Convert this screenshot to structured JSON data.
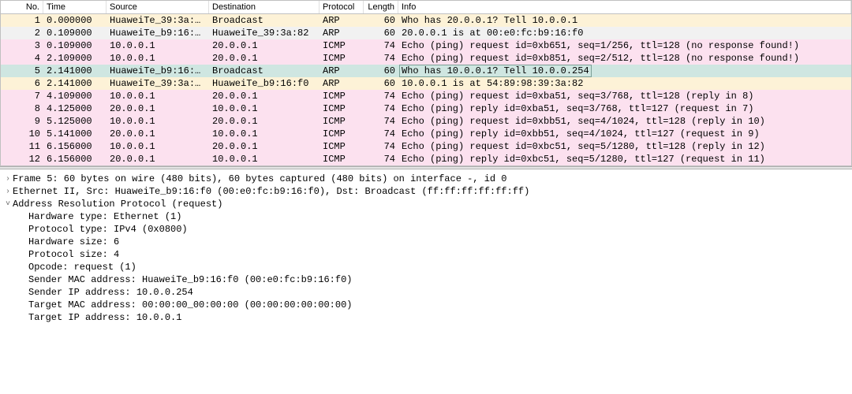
{
  "columns": {
    "no": "No.",
    "time": "Time",
    "source": "Source",
    "destination": "Destination",
    "protocol": "Protocol",
    "length": "Length",
    "info": "Info"
  },
  "packets": [
    {
      "no": "1",
      "time": "0.000000",
      "src": "HuaweiTe_39:3a:…",
      "dst": "Broadcast",
      "proto": "ARP",
      "len": "60",
      "info": "Who has 20.0.0.1? Tell 10.0.0.1",
      "cls": "arp-brd"
    },
    {
      "no": "2",
      "time": "0.109000",
      "src": "HuaweiTe_b9:16:…",
      "dst": "HuaweiTe_39:3a:82",
      "proto": "ARP",
      "len": "60",
      "info": "20.0.0.1 is at 00:e0:fc:b9:16:f0",
      "cls": "arp-resp"
    },
    {
      "no": "3",
      "time": "0.109000",
      "src": "10.0.0.1",
      "dst": "20.0.0.1",
      "proto": "ICMP",
      "len": "74",
      "info": "Echo (ping) request  id=0xb651, seq=1/256, ttl=128 (no response found!)",
      "cls": "icmp"
    },
    {
      "no": "4",
      "time": "2.109000",
      "src": "10.0.0.1",
      "dst": "20.0.0.1",
      "proto": "ICMP",
      "len": "74",
      "info": "Echo (ping) request  id=0xb851, seq=2/512, ttl=128 (no response found!)",
      "cls": "icmp"
    },
    {
      "no": "5",
      "time": "2.141000",
      "src": "HuaweiTe_b9:16:…",
      "dst": "Broadcast",
      "proto": "ARP",
      "len": "60",
      "info": "Who has 10.0.0.1? Tell 10.0.0.254",
      "cls": "selected"
    },
    {
      "no": "6",
      "time": "2.141000",
      "src": "HuaweiTe_39:3a:…",
      "dst": "HuaweiTe_b9:16:f0",
      "proto": "ARP",
      "len": "60",
      "info": "10.0.0.1 is at 54:89:98:39:3a:82",
      "cls": "arp-brd"
    },
    {
      "no": "7",
      "time": "4.109000",
      "src": "10.0.0.1",
      "dst": "20.0.0.1",
      "proto": "ICMP",
      "len": "74",
      "info": "Echo (ping) request  id=0xba51, seq=3/768, ttl=128 (reply in 8)",
      "cls": "icmp"
    },
    {
      "no": "8",
      "time": "4.125000",
      "src": "20.0.0.1",
      "dst": "10.0.0.1",
      "proto": "ICMP",
      "len": "74",
      "info": "Echo (ping) reply    id=0xba51, seq=3/768, ttl=127 (request in 7)",
      "cls": "icmp"
    },
    {
      "no": "9",
      "time": "5.125000",
      "src": "10.0.0.1",
      "dst": "20.0.0.1",
      "proto": "ICMP",
      "len": "74",
      "info": "Echo (ping) request  id=0xbb51, seq=4/1024, ttl=128 (reply in 10)",
      "cls": "icmp"
    },
    {
      "no": "10",
      "time": "5.141000",
      "src": "20.0.0.1",
      "dst": "10.0.0.1",
      "proto": "ICMP",
      "len": "74",
      "info": "Echo (ping) reply    id=0xbb51, seq=4/1024, ttl=127 (request in 9)",
      "cls": "icmp"
    },
    {
      "no": "11",
      "time": "6.156000",
      "src": "10.0.0.1",
      "dst": "20.0.0.1",
      "proto": "ICMP",
      "len": "74",
      "info": "Echo (ping) request  id=0xbc51, seq=5/1280, ttl=128 (reply in 12)",
      "cls": "icmp"
    },
    {
      "no": "12",
      "time": "6.156000",
      "src": "20.0.0.1",
      "dst": "10.0.0.1",
      "proto": "ICMP",
      "len": "74",
      "info": "Echo (ping) reply    id=0xbc51, seq=5/1280, ttl=127 (request in 11)",
      "cls": "icmp"
    }
  ],
  "details": {
    "frame": "Frame 5: 60 bytes on wire (480 bits), 60 bytes captured (480 bits) on interface -, id 0",
    "eth": "Ethernet II, Src: HuaweiTe_b9:16:f0 (00:e0:fc:b9:16:f0), Dst: Broadcast (ff:ff:ff:ff:ff:ff)",
    "arp_hdr": "Address Resolution Protocol (request)",
    "arp": {
      "hwtype": "Hardware type: Ethernet (1)",
      "prototype": "Protocol type: IPv4 (0x0800)",
      "hwsize": "Hardware size: 6",
      "protosize": "Protocol size: 4",
      "opcode": "Opcode: request (1)",
      "sender_mac": "Sender MAC address: HuaweiTe_b9:16:f0 (00:e0:fc:b9:16:f0)",
      "sender_ip": "Sender IP address: 10.0.0.254",
      "target_mac": "Target MAC address: 00:00:00_00:00:00 (00:00:00:00:00:00)",
      "target_ip": "Target IP address: 10.0.0.1"
    }
  },
  "twisty": {
    "right": "›",
    "down": "˅"
  }
}
